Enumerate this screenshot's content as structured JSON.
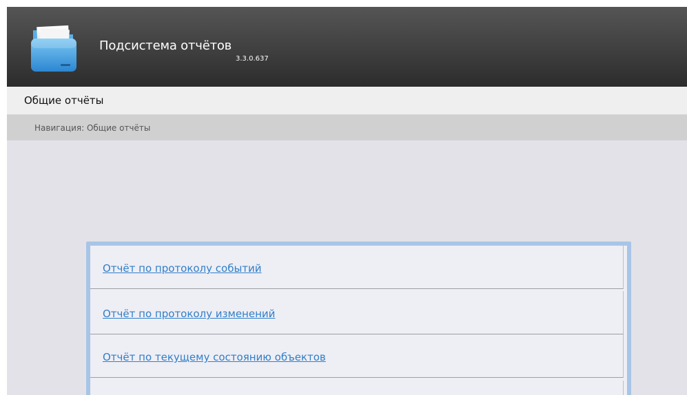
{
  "app": {
    "title": "Подсистема отчётов",
    "version": "3.3.0.637"
  },
  "menu": {
    "title": "Общие отчёты"
  },
  "breadcrumb": {
    "text": "Навигация: Общие отчёты"
  },
  "reports": [
    {
      "label": "Отчёт по протоколу событий"
    },
    {
      "label": "Отчёт по протоколу изменений"
    },
    {
      "label": "Отчёт по текущему состоянию объектов"
    },
    {
      "label": ""
    }
  ],
  "icons": {
    "logo": "folder-icon"
  },
  "colors": {
    "header": "#3f3f3f",
    "link": "#2f7fc8",
    "panel_border": "#a7c5e6",
    "background": "#e3e2e8"
  }
}
